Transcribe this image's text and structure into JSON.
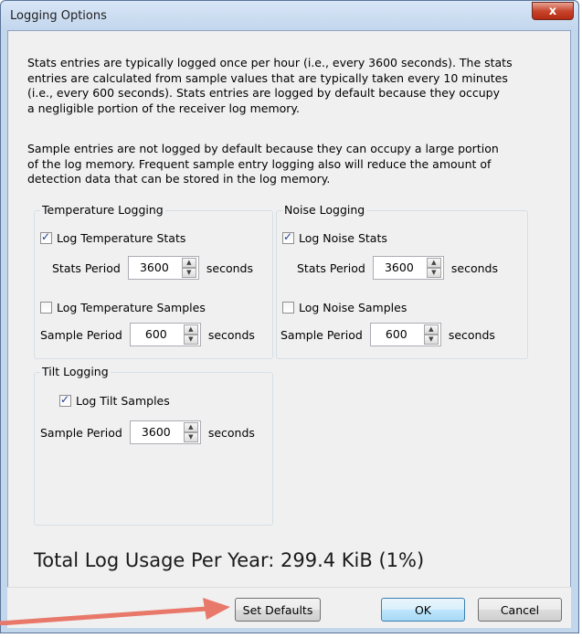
{
  "window": {
    "title": "Logging Options",
    "close_label": "x"
  },
  "description": {
    "para1": "Stats entries are typically logged once per hour (i.e., every 3600 seconds). The stats entries are calculated from sample values that are typically taken every 10 minutes (i.e., every 600 seconds). Stats entries are logged by default because they occupy a negligible portion of the receiver log memory.",
    "para1_lines": [
      "Stats entries are typically logged once per hour (i.e., every 3600 seconds). The stats",
      "entries are calculated from sample values that are typically taken every 10 minutes",
      "(i.e., every 600 seconds). Stats entries are logged by default because they occupy",
      "a negligible portion of the receiver log memory."
    ],
    "para2_lines": [
      "Sample entries are not logged by default because they can occupy a large portion",
      "of the log memory. Frequent sample entry logging also will reduce the amount of",
      "detection data that can be stored in the log memory."
    ]
  },
  "temperature": {
    "title": "Temperature Logging",
    "stats_checkbox_label": "Log Temperature Stats",
    "stats_checked": true,
    "stats_period_label": "Stats Period",
    "stats_period_value": "3600",
    "stats_unit": "seconds",
    "samples_checkbox_label": "Log Temperature Samples",
    "samples_checked": false,
    "sample_period_label": "Sample Period",
    "sample_period_value": "600",
    "sample_unit": "seconds"
  },
  "noise": {
    "title": "Noise Logging",
    "stats_checkbox_label": "Log Noise Stats",
    "stats_checked": true,
    "stats_period_label": "Stats Period",
    "stats_period_value": "3600",
    "stats_unit": "seconds",
    "samples_checkbox_label": "Log Noise Samples",
    "samples_checked": false,
    "sample_period_label": "Sample Period",
    "sample_period_value": "600",
    "sample_unit": "seconds"
  },
  "tilt": {
    "title": "Tilt Logging",
    "samples_checkbox_label": "Log Tilt Samples",
    "samples_checked": true,
    "sample_period_label": "Sample Period",
    "sample_period_value": "3600",
    "sample_unit": "seconds"
  },
  "summary": {
    "total_label": "Total Log Usage Per Year: 299.4 KiB (1%)"
  },
  "buttons": {
    "set_defaults": "Set Defaults",
    "ok": "OK",
    "cancel": "Cancel"
  },
  "colors": {
    "annotation_arrow": "#e8786a",
    "titlebar": "#c3d6ed",
    "close_button": "#c7452e"
  },
  "icons": {
    "close": "close-icon",
    "spin_up": "spin-up-icon",
    "spin_down": "spin-down-icon",
    "annotation": "arrow-pointer-icon"
  }
}
